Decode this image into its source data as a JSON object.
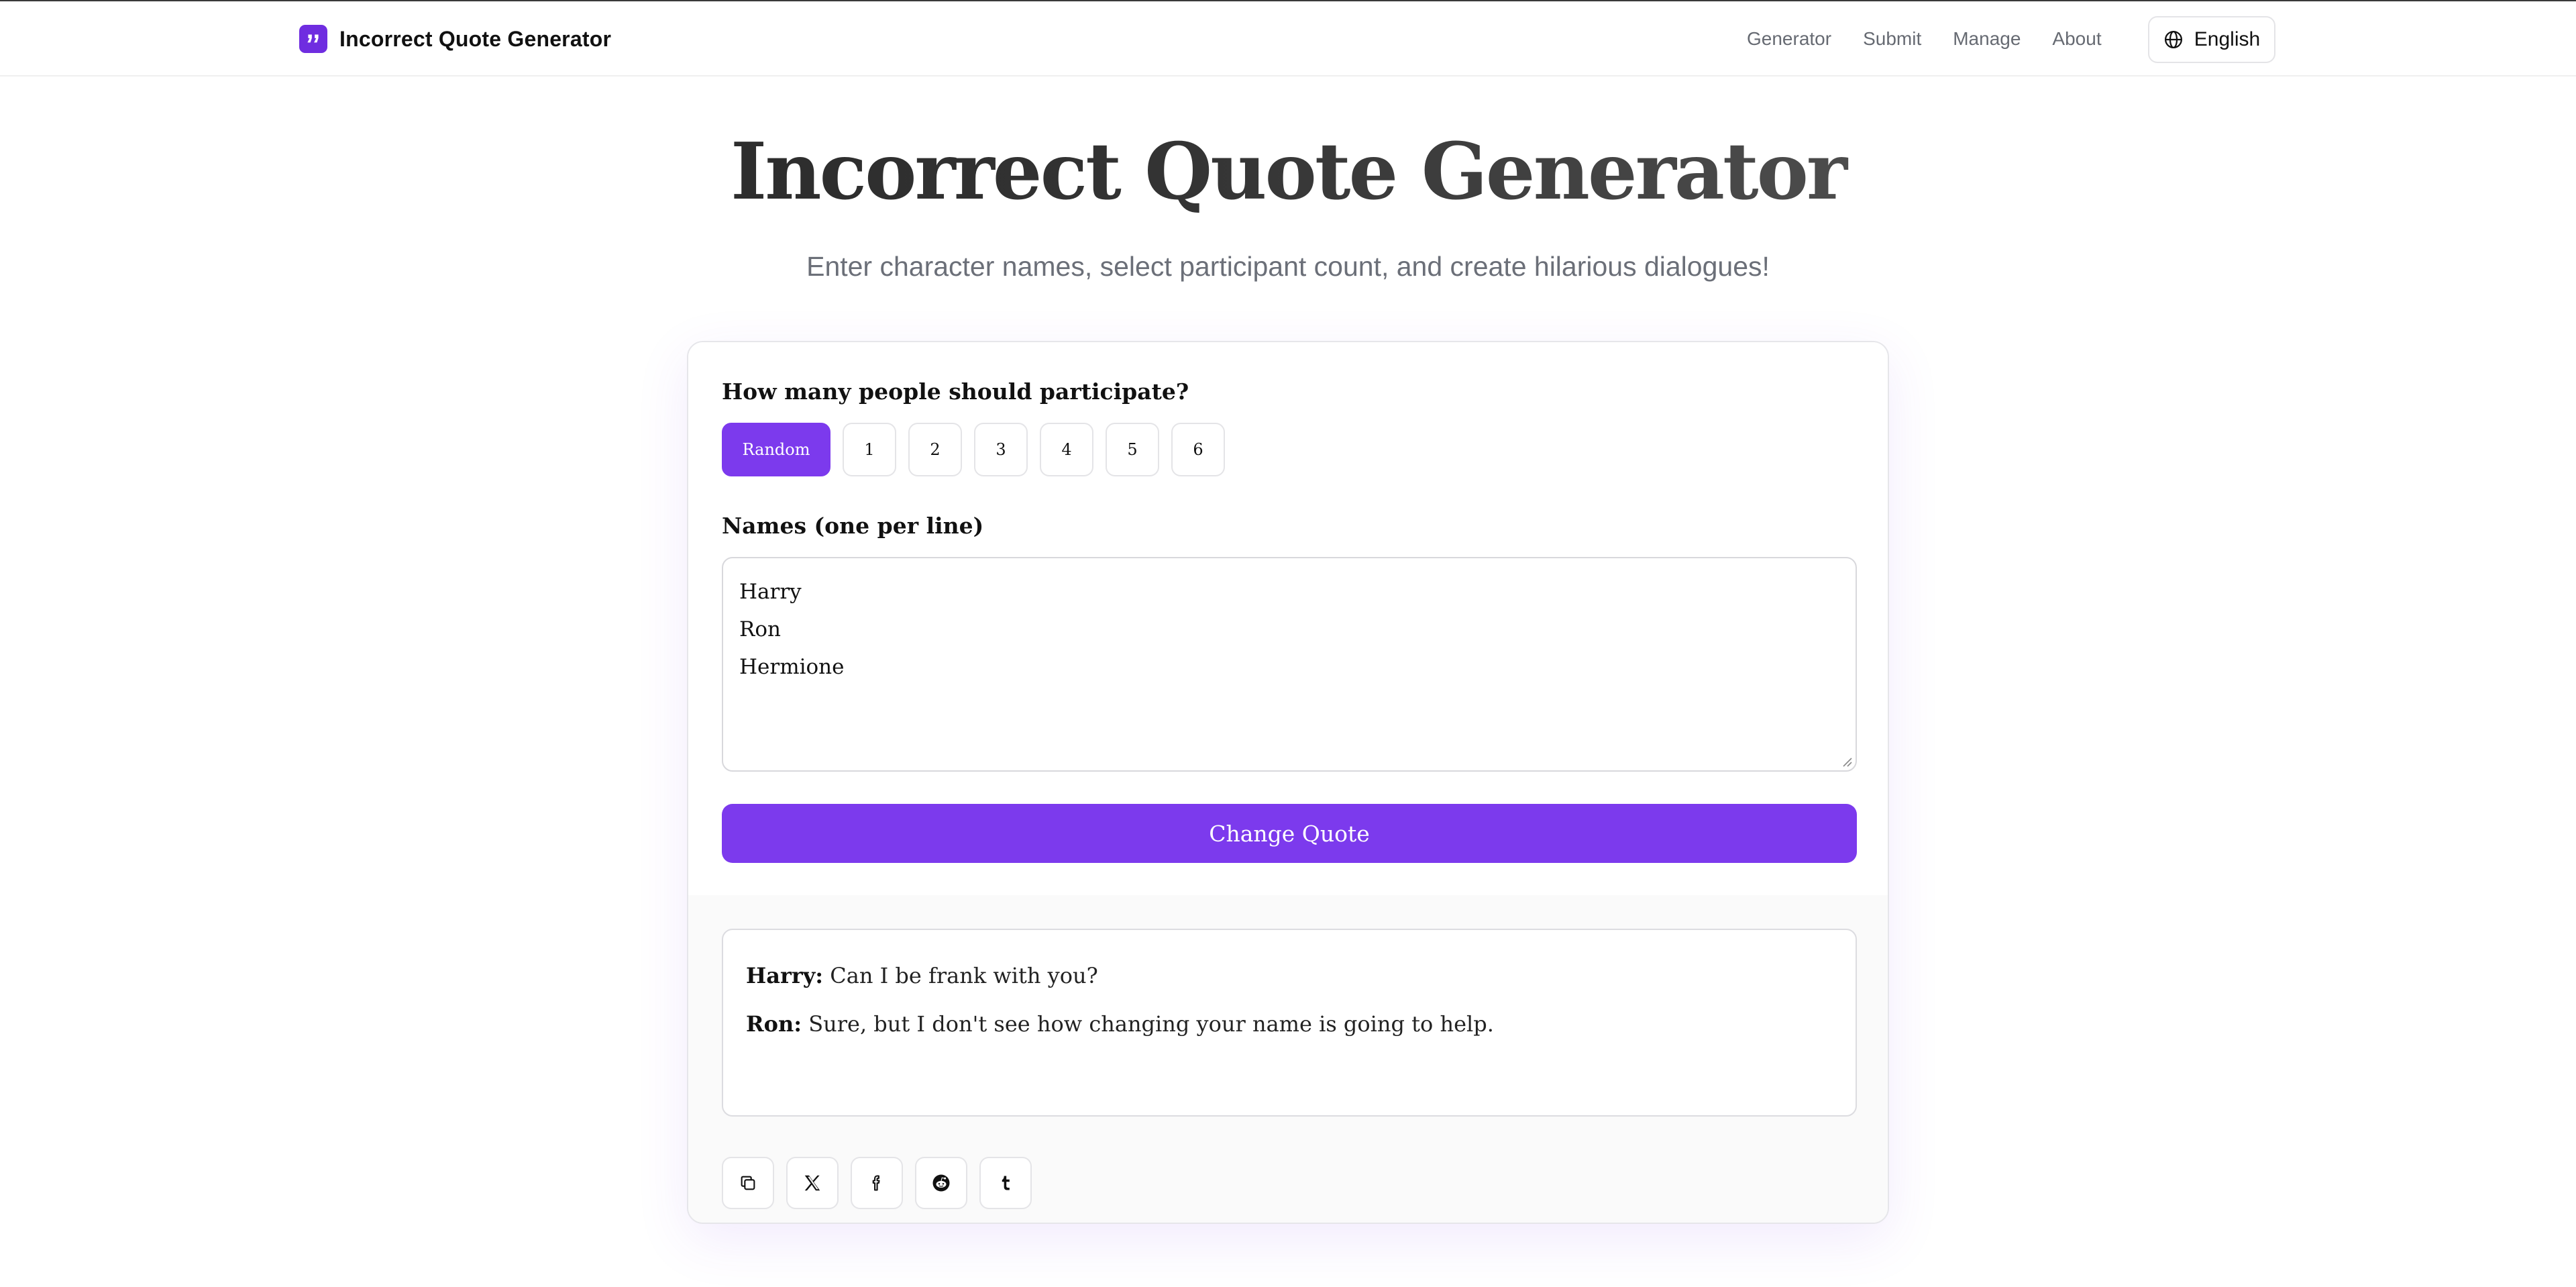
{
  "header": {
    "brand_name": "Incorrect Quote Generator",
    "nav": [
      "Generator",
      "Submit",
      "Manage",
      "About"
    ],
    "language": "English"
  },
  "hero": {
    "title": "Incorrect Quote Generator",
    "subtitle": "Enter character names, select participant count, and create hilarious dialogues!"
  },
  "form": {
    "participants_label": "How many people should participate?",
    "participant_options": [
      "Random",
      "1",
      "2",
      "3",
      "4",
      "5",
      "6"
    ],
    "selected_option": "Random",
    "names_label": "Names (one per line)",
    "names": [
      "Harry",
      "Ron",
      "Hermione"
    ],
    "change_button": "Change Quote"
  },
  "quote": {
    "lines": [
      {
        "speaker": "Harry:",
        "text": "Can I be frank with you?"
      },
      {
        "speaker": "Ron:",
        "text": "Sure, but I don't see how changing your name is going to help."
      }
    ]
  },
  "share": {
    "buttons": [
      "copy-icon",
      "x-icon",
      "facebook-icon",
      "reddit-icon",
      "tumblr-icon"
    ]
  },
  "colors": {
    "accent": "#7c3aed",
    "brand_logo": "#6f2de0",
    "muted_text": "#6b6f78"
  }
}
